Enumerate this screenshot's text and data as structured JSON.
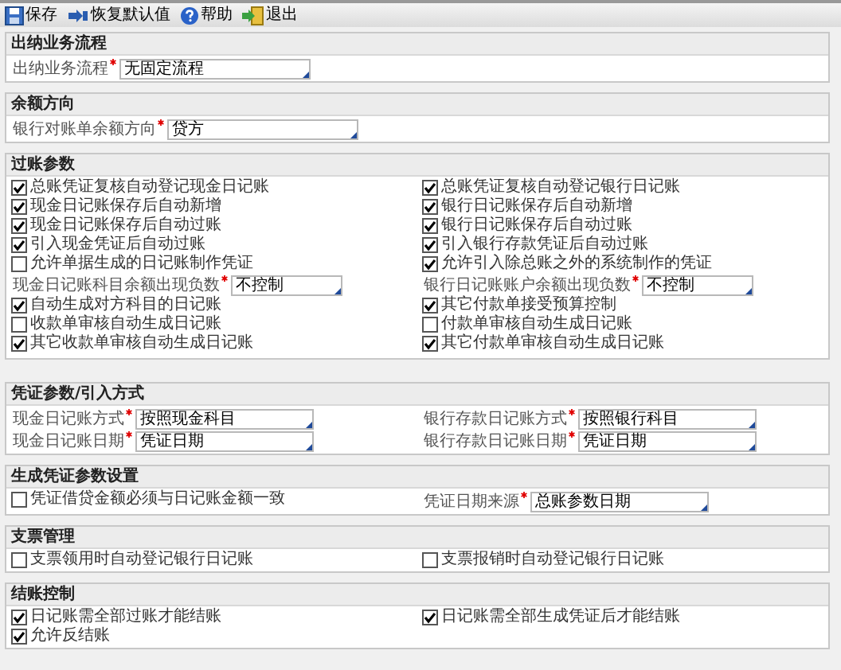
{
  "toolbar": [
    {
      "kind": "save",
      "label": "保存"
    },
    {
      "kind": "restore",
      "label": "恢复默认值"
    },
    {
      "kind": "help",
      "label": "帮助"
    },
    {
      "kind": "exit",
      "label": "退出"
    }
  ],
  "sections": [
    {
      "title": "出纳业务流程",
      "rows": [
        [
          {
            "kind": "select",
            "label": "出纳业务流程",
            "required": true,
            "value": "无固定流程"
          }
        ]
      ]
    },
    {
      "title": "余额方向",
      "rows": [
        [
          {
            "kind": "select",
            "label": "银行对账单余额方向",
            "required": true,
            "value": "贷方"
          }
        ]
      ]
    },
    {
      "title": "过账参数",
      "rows": [
        [
          {
            "kind": "checkbox",
            "label": "总账凭证复核自动登记现金日记账",
            "checked": true
          },
          {
            "kind": "checkbox",
            "label": "总账凭证复核自动登记银行日记账",
            "checked": true
          }
        ],
        [
          {
            "kind": "checkbox",
            "label": "现金日记账保存后自动新增",
            "checked": true
          },
          {
            "kind": "checkbox",
            "label": "银行日记账保存后自动新增",
            "checked": true
          }
        ],
        [
          {
            "kind": "checkbox",
            "label": "现金日记账保存后自动过账",
            "checked": true
          },
          {
            "kind": "checkbox",
            "label": "银行日记账保存后自动过账",
            "checked": true
          }
        ],
        [
          {
            "kind": "checkbox",
            "label": "引入现金凭证后自动过账",
            "checked": true
          },
          {
            "kind": "checkbox",
            "label": "引入银行存款凭证后自动过账",
            "checked": true
          }
        ],
        [
          {
            "kind": "checkbox",
            "label": "允许单据生成的日记账制作凭证",
            "checked": false
          },
          {
            "kind": "checkbox",
            "label": "允许引入除总账之外的系统制作的凭证",
            "checked": true
          }
        ],
        [
          {
            "kind": "select",
            "label": "现金日记账科目余额出现负数",
            "required": true,
            "value": "不控制"
          },
          {
            "kind": "select",
            "label": "银行日记账账户余额出现负数",
            "required": true,
            "value": "不控制"
          }
        ],
        [
          {
            "kind": "checkbox",
            "label": "自动生成对方科目的日记账",
            "checked": true
          },
          {
            "kind": "checkbox",
            "label": "其它付款单接受预算控制",
            "checked": true
          }
        ],
        [
          {
            "kind": "checkbox",
            "label": "收款单审核自动生成日记账",
            "checked": false
          },
          {
            "kind": "checkbox",
            "label": "付款单审核自动生成日记账",
            "checked": false
          }
        ],
        [
          {
            "kind": "checkbox",
            "label": "其它收款单审核自动生成日记账",
            "checked": true
          },
          {
            "kind": "checkbox",
            "label": "其它付款单审核自动生成日记账",
            "checked": true
          }
        ]
      ]
    },
    {
      "title": "凭证参数/引入方式",
      "rows": [
        [
          {
            "kind": "select",
            "label": "现金日记账方式",
            "required": true,
            "value": "按照现金科目"
          },
          {
            "kind": "select",
            "label": "银行存款日记账方式",
            "required": true,
            "value": "按照银行科目"
          }
        ],
        [
          {
            "kind": "select",
            "label": "现金日记账日期",
            "required": true,
            "value": "凭证日期"
          },
          {
            "kind": "select",
            "label": "银行存款日记账日期",
            "required": true,
            "value": "凭证日期"
          }
        ]
      ]
    },
    {
      "title": "生成凭证参数设置",
      "rows": [
        [
          {
            "kind": "checkbox",
            "label": "凭证借贷金额必须与日记账金额一致",
            "checked": false
          },
          {
            "kind": "select",
            "label": "凭证日期来源",
            "required": true,
            "value": "总账参数日期"
          }
        ]
      ]
    },
    {
      "title": "支票管理",
      "rows": [
        [
          {
            "kind": "checkbox",
            "label": "支票领用时自动登记银行日记账",
            "checked": false
          },
          {
            "kind": "checkbox",
            "label": "支票报销时自动登记银行日记账",
            "checked": false
          }
        ]
      ]
    },
    {
      "title": "结账控制",
      "rows": [
        [
          {
            "kind": "checkbox",
            "label": "日记账需全部过账才能结账",
            "checked": true
          },
          {
            "kind": "checkbox",
            "label": "日记账需全部生成凭证后才能结账",
            "checked": true
          }
        ],
        [
          {
            "kind": "checkbox",
            "label": "允许反结账",
            "checked": true
          }
        ]
      ]
    }
  ]
}
